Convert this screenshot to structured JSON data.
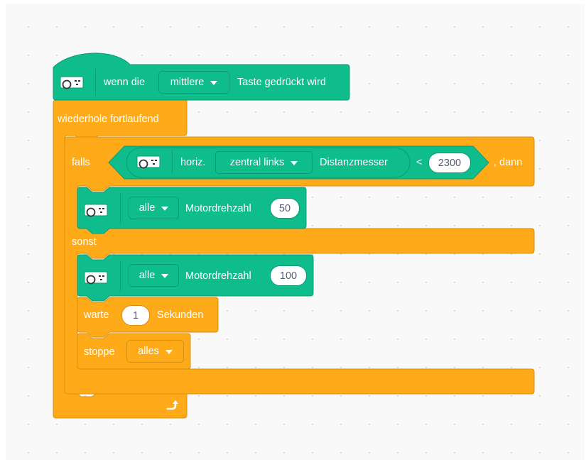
{
  "colors": {
    "motion_green": "#0fbd8c",
    "control_orange": "#ffab19",
    "workspace_bg": "#f9f9f9"
  },
  "hat_block": {
    "icon": "hub-sensor-icon",
    "prefix": "wenn die",
    "button_dropdown": "mittlere",
    "suffix": "Taste gedrückt wird"
  },
  "forever_block": {
    "label": "wiederhole fortlaufend",
    "loop_icon": "loop-arrow-icon"
  },
  "if_block": {
    "if_label": "falls",
    "then_label": ", dann",
    "else_label": "sonst",
    "condition": {
      "icon": "hub-sensor-icon",
      "orientation_label": "horiz.",
      "position_dropdown": "zentral links",
      "sensor_label": "Distanzmesser",
      "operator": "<",
      "value": "2300"
    }
  },
  "motor_block_1": {
    "icon": "hub-sensor-icon",
    "motors_dropdown": "alle",
    "label": "Motordrehzahl",
    "value": "50"
  },
  "motor_block_2": {
    "icon": "hub-sensor-icon",
    "motors_dropdown": "alle",
    "label": "Motordrehzahl",
    "value": "100"
  },
  "wait_block": {
    "prefix": "warte",
    "value": "1",
    "suffix": "Sekunden"
  },
  "stop_block": {
    "label": "stoppe",
    "dropdown": "alles"
  }
}
